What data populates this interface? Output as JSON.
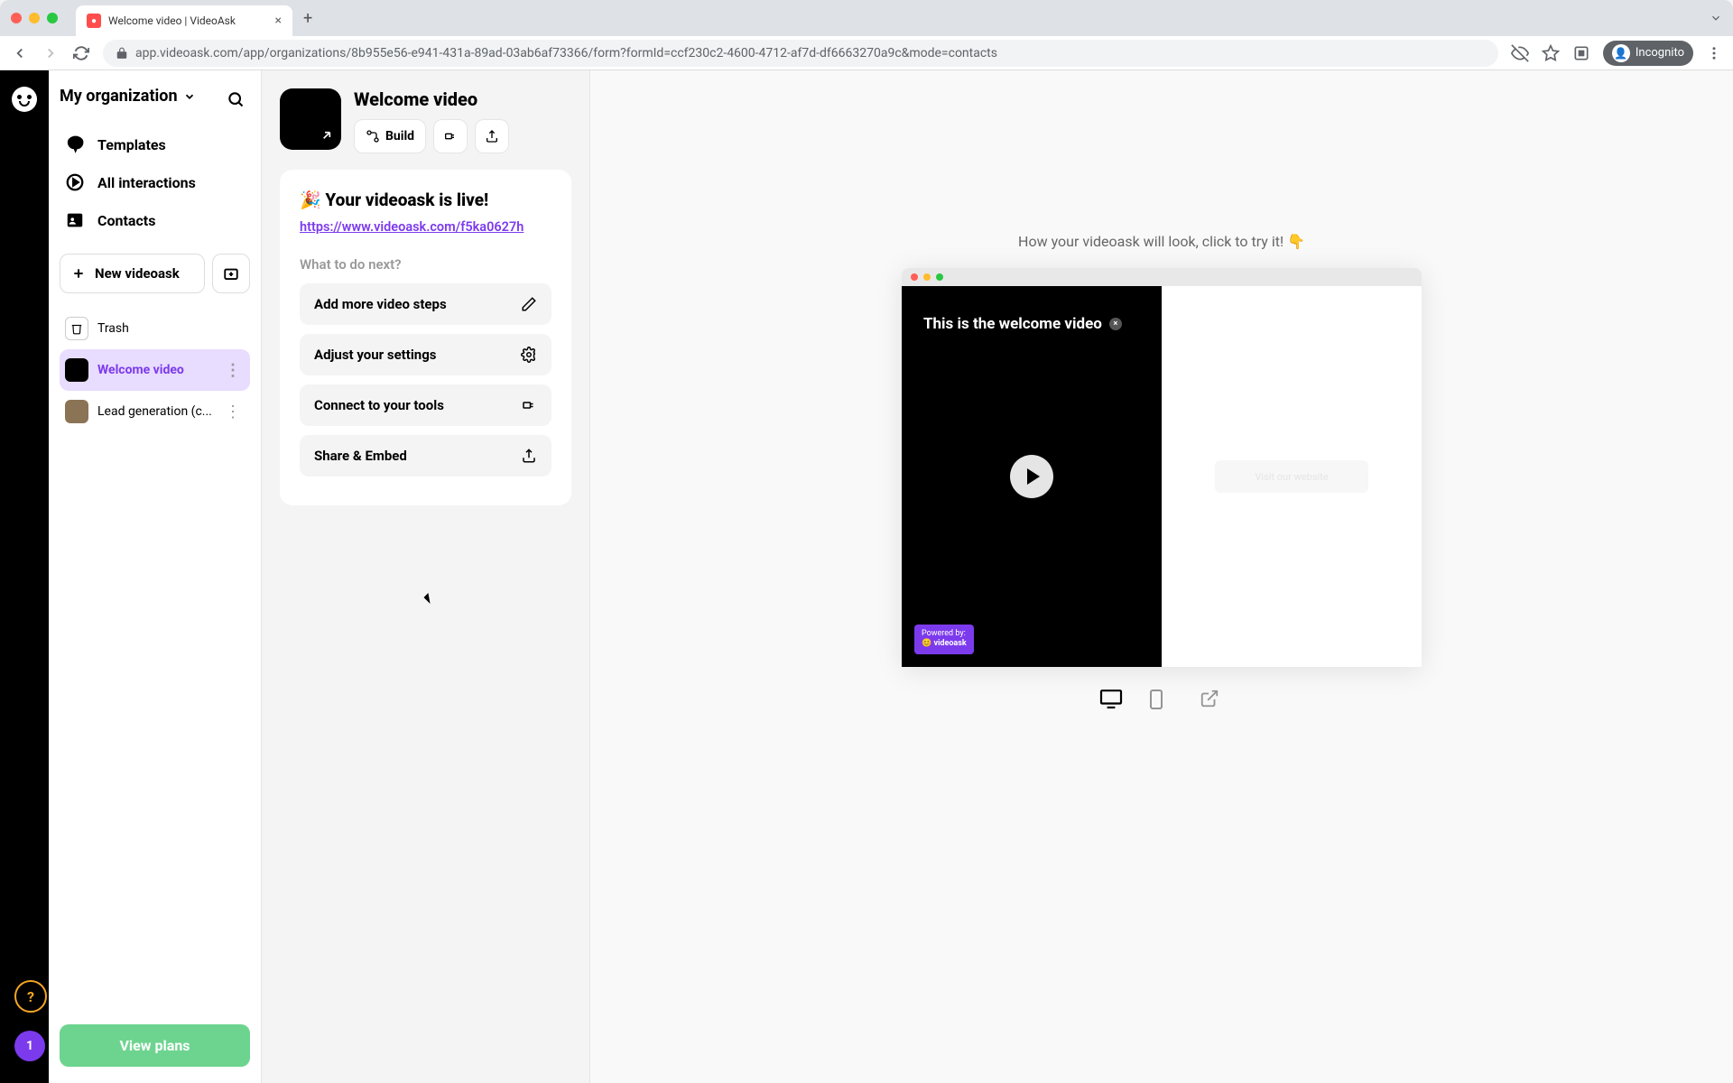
{
  "browser": {
    "tab_title": "Welcome video | VideoAsk",
    "url": "app.videoask.com/app/organizations/8b955e56-e941-431a-89ad-03ab6af73366/form?formId=ccf230c2-4600-4712-af7d-df6663270a9c&mode=contacts",
    "incognito_label": "Incognito"
  },
  "sidebar": {
    "org_name": "My organization",
    "nav": [
      {
        "label": "Templates"
      },
      {
        "label": "All interactions"
      },
      {
        "label": "Contacts"
      }
    ],
    "new_videoask": "New videoask",
    "trash": "Trash",
    "items": [
      {
        "label": "Welcome video",
        "active": true
      },
      {
        "label": "Lead generation (c...",
        "active": false
      }
    ],
    "help": "?",
    "badge": "1",
    "view_plans": "View plans"
  },
  "panel": {
    "title": "Welcome video",
    "build_label": "Build",
    "live_emoji": "🎉",
    "live_title": "Your videoask is live!",
    "live_url": "https://www.videoask.com/f5ka0627h",
    "next_label": "What to do next?",
    "actions": [
      {
        "label": "Add more video steps"
      },
      {
        "label": "Adjust your settings"
      },
      {
        "label": "Connect to your tools"
      },
      {
        "label": "Share & Embed"
      }
    ]
  },
  "preview": {
    "hint": "How your videoask will look, click to try it! 👇",
    "video_title": "This is the welcome video",
    "powered_top": "Powered by:",
    "powered_brand": "videoask",
    "ghost_cta": "Visit our website"
  }
}
